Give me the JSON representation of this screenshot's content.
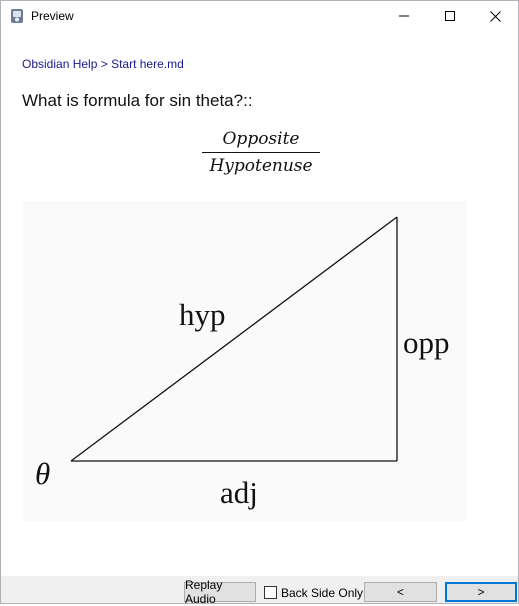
{
  "window": {
    "title": "Preview",
    "icon": "app-icon",
    "controls": [
      "minimize-icon",
      "maximize-icon",
      "close-icon"
    ]
  },
  "breadcrumb": {
    "parent": "Obsidian Help",
    "separator": ">",
    "current": "Start here.md"
  },
  "card": {
    "question": "What is formula for sin theta?::",
    "numerator": "Opposite",
    "denominator": "Hypotenuse"
  },
  "figure": {
    "hyp": "hyp",
    "opp": "opp",
    "adj": "adj",
    "angle": "θ"
  },
  "footer": {
    "replay_audio": "Replay Audio",
    "back_side_only": "Back Side Only",
    "back_side_only_checked": false,
    "prev": "<",
    "next": ">"
  },
  "colors": {
    "link": "#1a1a8c",
    "accent_focus": "#0078d7",
    "bar_bg": "#f0f0f0"
  }
}
